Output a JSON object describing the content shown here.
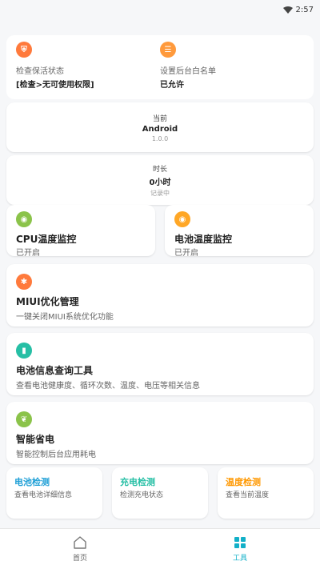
{
  "status_bar": {
    "time": "2:57"
  },
  "top_card": {
    "left": {
      "label": "检查保活状态",
      "value": "[检查>无可使用权限]",
      "color": "#ff7a3c"
    },
    "right": {
      "label": "设置后台白名单",
      "value": "已允许",
      "color": "#ff9a3c"
    }
  },
  "info_cards": [
    {
      "line1": "当前",
      "line2": "Android",
      "line3": "1.0.0"
    },
    {
      "line1": "时长",
      "line2": "0小时",
      "line3": "记录中"
    }
  ],
  "half_cards": [
    {
      "title": "CPU温度监控",
      "sub": "已开启",
      "color": "#8bc34a"
    },
    {
      "title": "电池温度监控",
      "sub": "已开启",
      "color": "#ffa726"
    }
  ],
  "list_cards": [
    {
      "title": "MIUI优化管理",
      "sub": "一键关闭MIUI系统优化功能",
      "color": "#ff7a3c"
    },
    {
      "title": "电池信息查询工具",
      "sub": "查看电池健康度、循环次数、温度、电压等相关信息",
      "color": "#26bfa5"
    },
    {
      "title": "智能省电",
      "sub": "智能控制后台应用耗电",
      "color": "#8bc34a"
    }
  ],
  "mini_cards": [
    {
      "title": "电池检测",
      "sub": "查看电池详细信息",
      "color": "#1e9fd6"
    },
    {
      "title": "充电检测",
      "sub": "检测充电状态",
      "color": "#26bfa5"
    },
    {
      "title": "温度检测",
      "sub": "查看当前温度",
      "color": "#ff9800"
    }
  ],
  "bottom_nav": [
    {
      "label": "首页",
      "icon": "home-icon",
      "active": false
    },
    {
      "label": "工具",
      "icon": "tools-icon",
      "active": true
    }
  ],
  "colors": {
    "accent": "#12b0c8"
  }
}
